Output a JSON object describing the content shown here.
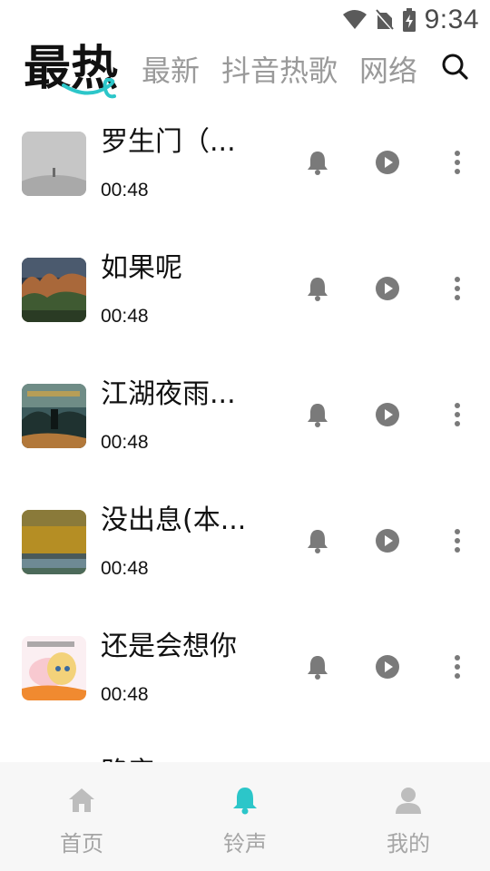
{
  "status_bar": {
    "time": "9:34"
  },
  "top_tabs": [
    {
      "label": "最热",
      "active": true
    },
    {
      "label": "最新",
      "active": false
    },
    {
      "label": "抖音热歌",
      "active": false
    },
    {
      "label": "网络",
      "active": false
    }
  ],
  "songs": [
    {
      "title": "罗生门（...",
      "duration": "00:48"
    },
    {
      "title": "如果呢",
      "duration": "00:48"
    },
    {
      "title": "江湖夜雨...",
      "duration": "00:48"
    },
    {
      "title": "没出息(本...",
      "duration": "00:48"
    },
    {
      "title": "还是会想你",
      "duration": "00:48"
    },
    {
      "title": "路彦",
      "duration": ""
    }
  ],
  "bottom_nav": [
    {
      "label": "首页",
      "icon": "home-icon",
      "active": false
    },
    {
      "label": "铃声",
      "icon": "bell-icon",
      "active": true
    },
    {
      "label": "我的",
      "icon": "user-icon",
      "active": false
    }
  ],
  "colors": {
    "accent": "#2cc6c9",
    "icon_gray": "#7a7a7a",
    "tab_inactive": "#9a9a9a",
    "nav_inactive": "#bdbdbd"
  }
}
